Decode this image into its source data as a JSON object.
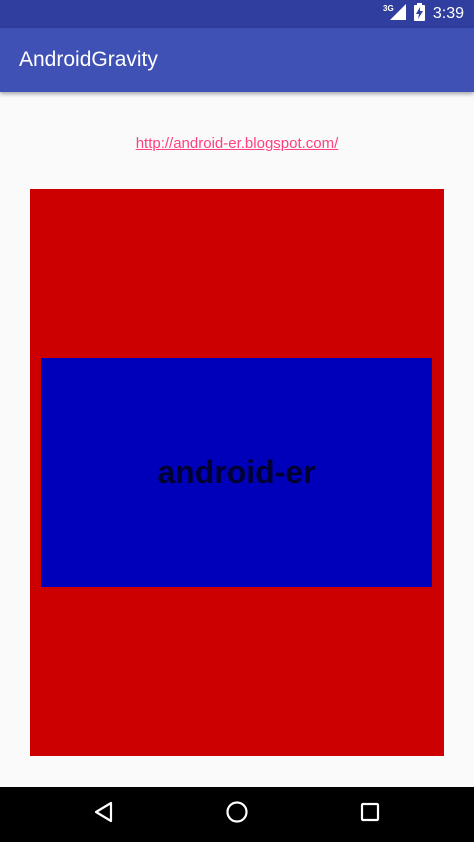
{
  "status_bar": {
    "network": "3G",
    "time": "3:39",
    "icons": [
      "signal-icon",
      "battery-charging-icon"
    ]
  },
  "app_bar": {
    "title": "AndroidGravity"
  },
  "content": {
    "link_text": "http://android-er.blogspot.com/",
    "inner_label": "android-er"
  },
  "nav_bar": {
    "icons": [
      "back-icon",
      "home-icon",
      "recents-icon"
    ]
  },
  "colors": {
    "status_bar": "#303f9f",
    "app_bar": "#3f51b5",
    "link": "#ff4081",
    "outer_box": "#cc0000",
    "inner_box": "#0000bb"
  }
}
